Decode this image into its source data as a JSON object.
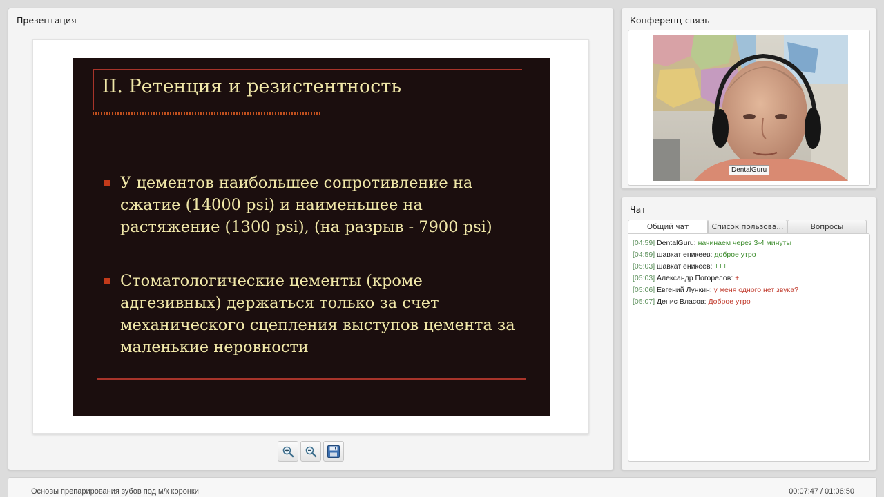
{
  "presentation": {
    "panel_title": "Презентация",
    "slide": {
      "title": "II. Ретенция и резистентность",
      "bullets": [
        "У цементов наибольшее сопротивление на сжатие (14000 psi) и наименьшее на растяжение (1300 psi), (на разрыв - 7900 psi)",
        "Стоматологические цементы (кроме адгезивных) держаться только за счет механического сцепления выступов цемента за маленькие неровности"
      ]
    },
    "toolbar": {
      "zoom_in_icon": "zoom-in-icon",
      "zoom_out_icon": "zoom-out-icon",
      "save_icon": "floppy-disk-icon"
    }
  },
  "conference": {
    "panel_title": "Конференц-связь",
    "video_name": "DentalGuru"
  },
  "chat": {
    "panel_title": "Чат",
    "tabs": [
      {
        "label": "Общий чат",
        "active": true
      },
      {
        "label": "Список пользова...",
        "active": false
      },
      {
        "label": "Вопросы",
        "active": false
      }
    ],
    "messages": [
      {
        "time": "[04:59]",
        "user": "DentalGuru",
        "text": "начинаем через 3-4 минуты",
        "color": "#3c8c2c"
      },
      {
        "time": "[04:59]",
        "user": "шавкат еникеев",
        "text": "доброе утро",
        "color": "#3c8c2c"
      },
      {
        "time": "[05:03]",
        "user": "шавкат еникеев",
        "text": "+++",
        "color": "#3c8c2c"
      },
      {
        "time": "[05:03]",
        "user": "Александр Погорелов",
        "text": "+",
        "color": "#c0392b"
      },
      {
        "time": "[05:06]",
        "user": "Евгений Лункин",
        "text": "у меня одного нет звука?",
        "color": "#c0392b"
      },
      {
        "time": "[05:07]",
        "user": "Денис Власов",
        "text": "Доброе утро",
        "color": "#c0392b"
      }
    ]
  },
  "footer": {
    "title": "Основы препарирования зубов под м/к коронки",
    "time": "00:07:47 / 01:06:50"
  },
  "colors": {
    "slide_bg": "#1b0e0e",
    "slide_text": "#f0e7a8",
    "slide_accent": "#a8342a"
  }
}
